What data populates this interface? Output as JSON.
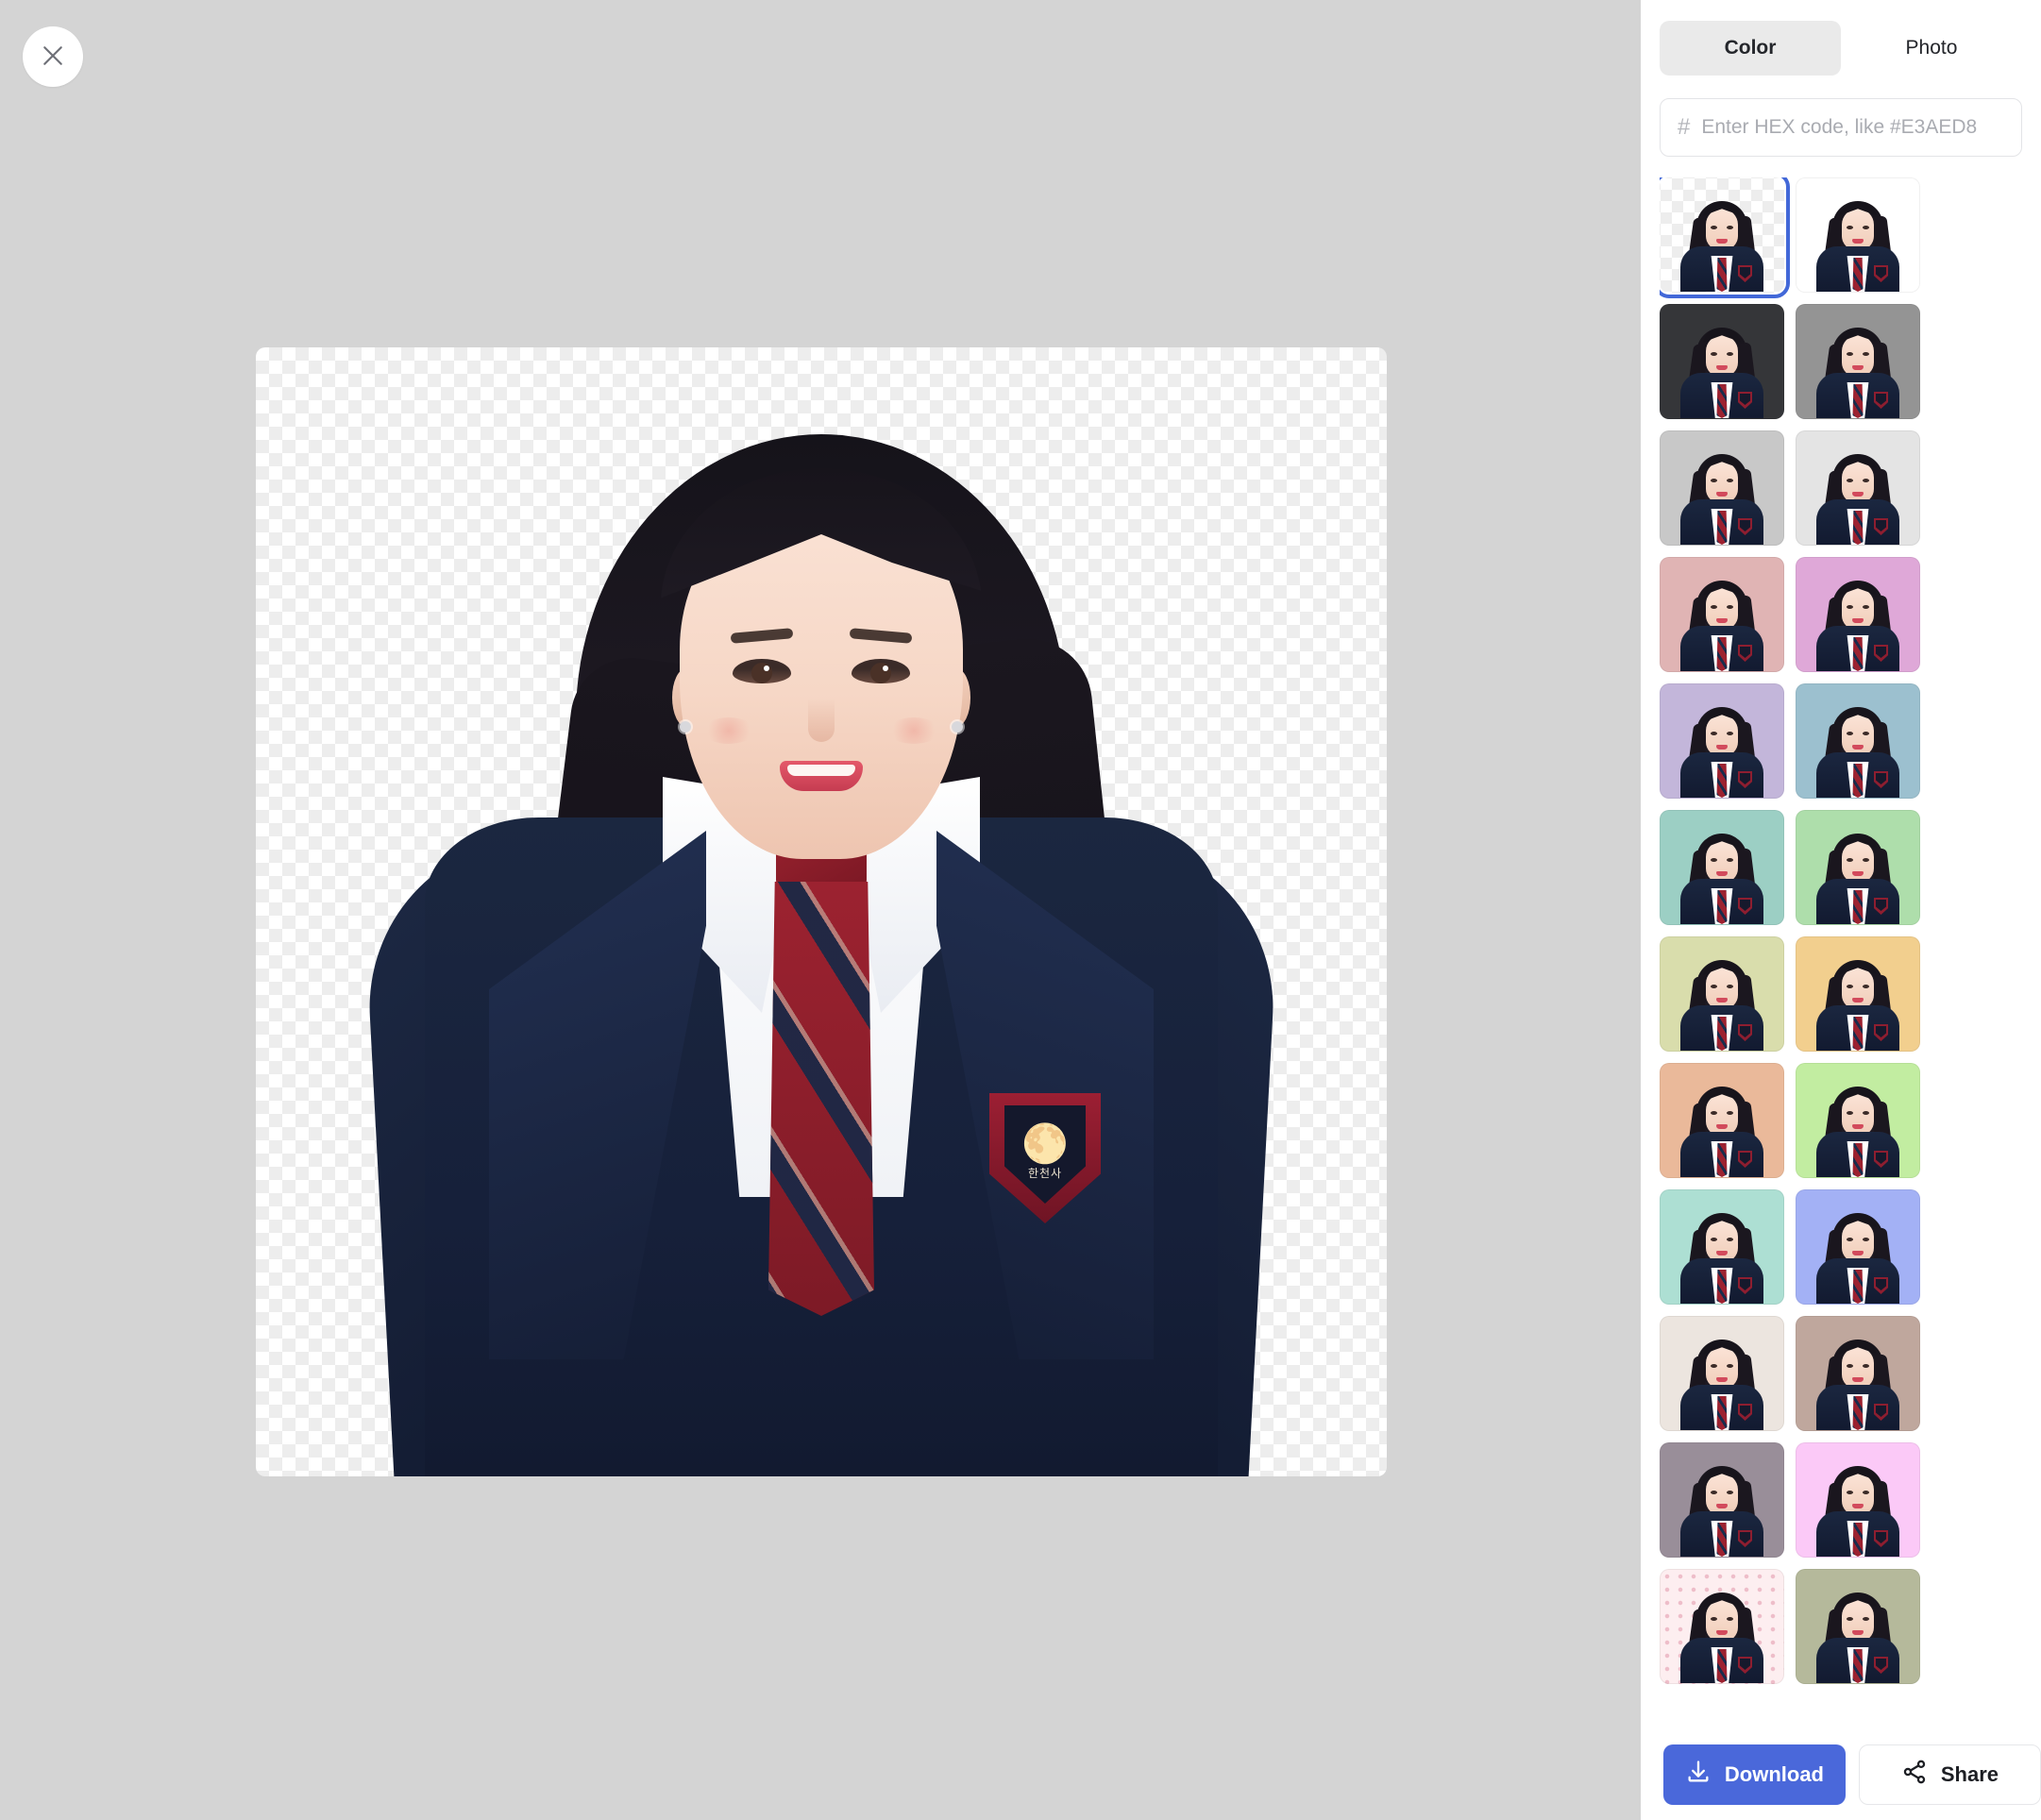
{
  "window": {
    "close_label": "Close",
    "stage_background": "#d4d4d4",
    "accent": "#4a68da"
  },
  "canvas": {
    "name": "portrait-preview",
    "background_type": "transparent-checkerboard",
    "checker_light": "#ffffff",
    "checker_dark": "#ededed",
    "subject": {
      "description": "Young woman in navy school blazer",
      "blazer_color": "#16203a",
      "shirt_color": "#ffffff",
      "tie_color": "#9c2230",
      "hair_color": "#17141b",
      "badge_text": "한천사"
    }
  },
  "sidebar": {
    "tabs": [
      {
        "label": "Color",
        "active": true
      },
      {
        "label": "Photo",
        "active": false
      }
    ],
    "hex_field": {
      "prefix": "#",
      "value": "",
      "placeholder": "Enter HEX code, like #E3AED8"
    },
    "swatches": [
      {
        "name": "transparent",
        "color": "transparent",
        "selected": true,
        "pattern": "checker"
      },
      {
        "name": "white",
        "color": "#ffffff",
        "selected": false,
        "pattern": "solid"
      },
      {
        "name": "charcoal",
        "color": "#353639",
        "selected": false,
        "pattern": "solid"
      },
      {
        "name": "mid-gray",
        "color": "#949494",
        "selected": false,
        "pattern": "solid"
      },
      {
        "name": "light-gray",
        "color": "#c8c8c8",
        "selected": false,
        "pattern": "solid"
      },
      {
        "name": "pale-gray",
        "color": "#e4e4e4",
        "selected": false,
        "pattern": "solid"
      },
      {
        "name": "dusty-rose",
        "color": "#e0b4b4",
        "selected": false,
        "pattern": "solid"
      },
      {
        "name": "orchid-pink",
        "color": "#dfa8d8",
        "selected": false,
        "pattern": "solid"
      },
      {
        "name": "lavender",
        "color": "#c3b6da",
        "selected": false,
        "pattern": "solid"
      },
      {
        "name": "dusty-blue",
        "color": "#9cc0cf",
        "selected": false,
        "pattern": "solid"
      },
      {
        "name": "teal-mint",
        "color": "#9ccfc4",
        "selected": false,
        "pattern": "solid"
      },
      {
        "name": "soft-green",
        "color": "#aedeab",
        "selected": false,
        "pattern": "solid"
      },
      {
        "name": "pale-olive",
        "color": "#d9ddac",
        "selected": false,
        "pattern": "solid"
      },
      {
        "name": "warm-sand",
        "color": "#f2cf8e",
        "selected": false,
        "pattern": "solid"
      },
      {
        "name": "peach",
        "color": "#eab99a",
        "selected": false,
        "pattern": "solid"
      },
      {
        "name": "light-lime",
        "color": "#c2eda1",
        "selected": false,
        "pattern": "solid"
      },
      {
        "name": "aqua-mint",
        "color": "#addfd3",
        "selected": false,
        "pattern": "solid"
      },
      {
        "name": "periwinkle",
        "color": "#a3b1f5",
        "selected": false,
        "pattern": "solid"
      },
      {
        "name": "ivory",
        "color": "#ece5df",
        "selected": false,
        "pattern": "solid"
      },
      {
        "name": "taupe",
        "color": "#bfa79d",
        "selected": false,
        "pattern": "solid"
      },
      {
        "name": "mauve-gray",
        "color": "#998e99",
        "selected": false,
        "pattern": "solid"
      },
      {
        "name": "cotton-pink",
        "color": "#fbc9f7",
        "selected": false,
        "pattern": "solid"
      },
      {
        "name": "blush-dots",
        "color": "#fdeef0",
        "selected": false,
        "pattern": "dots"
      },
      {
        "name": "sage",
        "color": "#b5b99b",
        "selected": false,
        "pattern": "solid"
      }
    ]
  },
  "footer": {
    "download_label": "Download",
    "share_label": "Share"
  }
}
